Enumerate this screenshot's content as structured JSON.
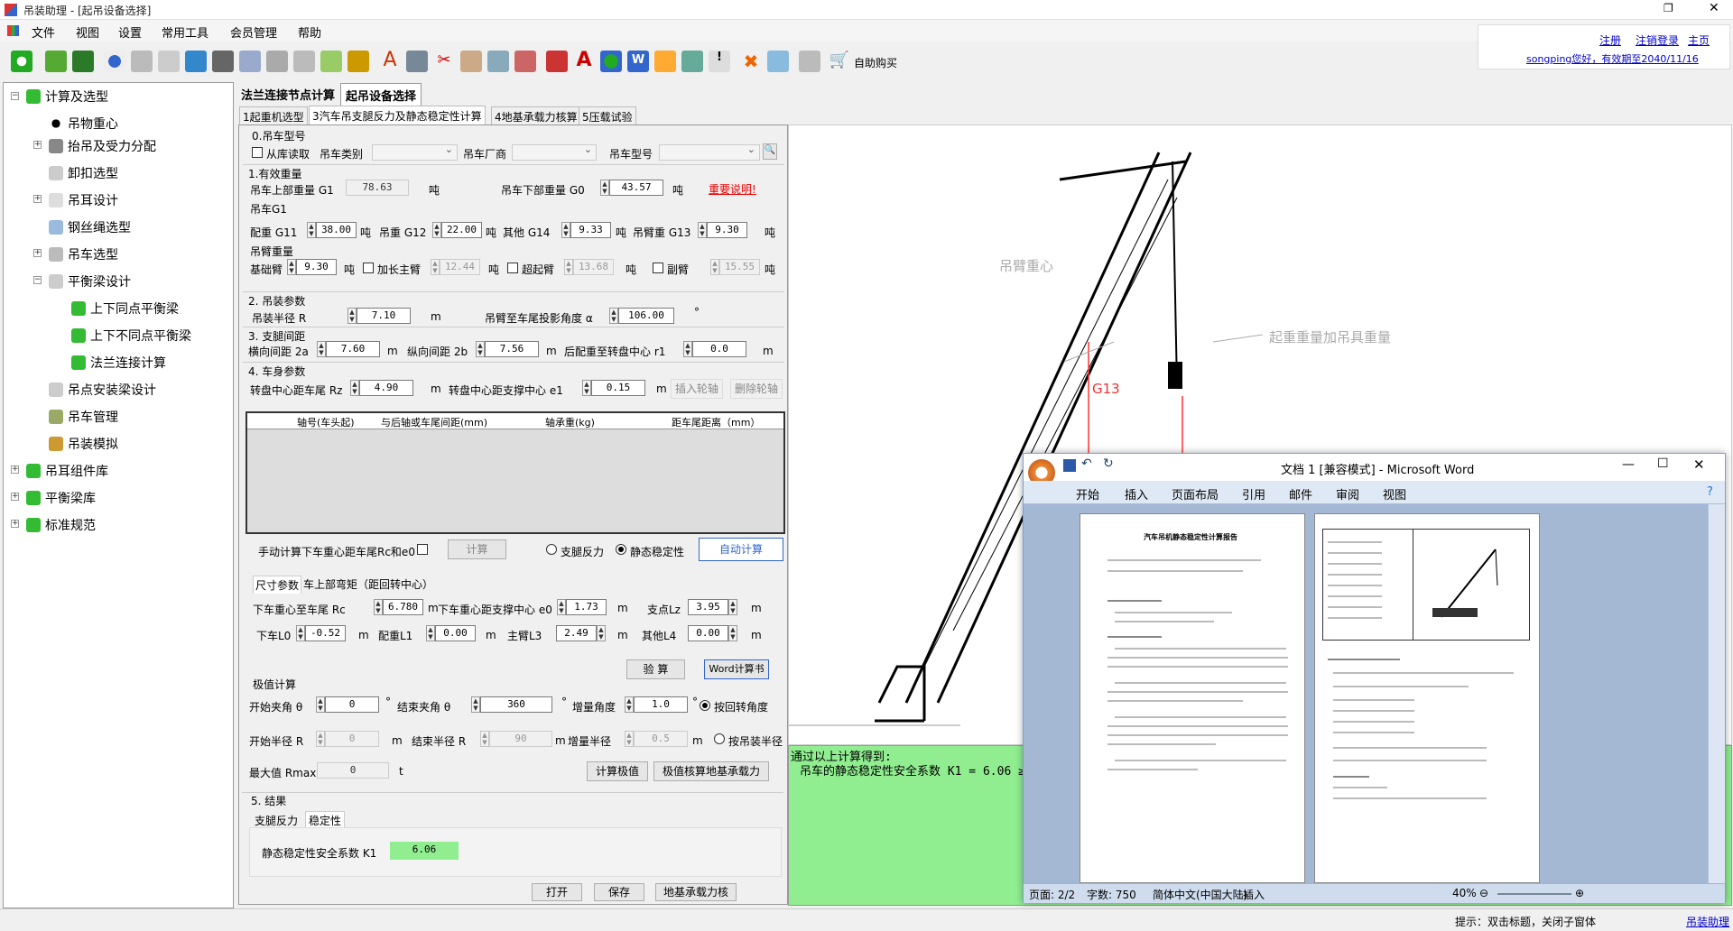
{
  "app": {
    "title": "吊装助理 - [起吊设备选择]"
  },
  "menu": [
    "文件",
    "视图",
    "设置",
    "常用工具",
    "会员管理",
    "帮助"
  ],
  "toolbar": {
    "buy": "自助购买"
  },
  "user": {
    "register": "注册",
    "logout": "注销登录",
    "home": "主页",
    "greeting": "songping您好，有效期至2040/11/16"
  },
  "tree": {
    "root": "计算及选型",
    "items": [
      "吊物重心",
      "抬吊及受力分配",
      "卸扣选型",
      "吊耳设计",
      "钢丝绳选型",
      "吊车选型",
      "平衡梁设计"
    ],
    "sub": [
      "上下同点平衡梁",
      "上下不同点平衡梁",
      "法兰连接计算"
    ],
    "items2": [
      "吊点安装梁设计",
      "吊车管理",
      "吊装模拟"
    ],
    "roots": [
      "吊耳组件库",
      "平衡梁库",
      "标准规范"
    ]
  },
  "tabs": [
    "法兰连接节点计算",
    "起吊设备选择"
  ],
  "subtabs": [
    "1起重机选型",
    "3汽车吊支腿反力及静态稳定性计算",
    "4地基承载力核算",
    "5压载试验"
  ],
  "s0": {
    "title": "0.吊车型号",
    "from_lib": "从库读取",
    "type": "吊车类别",
    "maker": "吊车厂商",
    "model": "吊车型号"
  },
  "s1": {
    "title": "1.有效重量",
    "upper": "吊车上部重量 G1",
    "upper_v": "78.63",
    "unit": "吨",
    "lower": "吊车下部重量 G0",
    "lower_v": "43.57",
    "note": "重要说明!",
    "g1": "吊车G1",
    "cw": "配重 G11",
    "cw_v": "38.00",
    "hook": "吊重 G12",
    "hook_v": "22.00",
    "other": "其他 G14",
    "other_v": "9.33",
    "boom": "吊臂重 G13",
    "boom_v": "9.30",
    "bw": "吊臂重量",
    "base": "基础臂",
    "base_v": "9.30",
    "ext": "加长主臂",
    "ext_v": "12.44",
    "super": "超起臂",
    "super_v": "13.68",
    "jib": "副臂",
    "jib_v": "15.55"
  },
  "s2": {
    "title": "2. 吊装参数",
    "radius": "吊装半径 R",
    "radius_v": "7.10",
    "m": "m",
    "angle": "吊臂至车尾投影角度 α",
    "angle_v": "106.00",
    "deg": "°"
  },
  "s3": {
    "title": "3. 支腿间距",
    "lat": "横向间距 2a",
    "lat_v": "7.60",
    "lon": "纵向间距 2b",
    "lon_v": "7.56",
    "rear": "后配重至转盘中心 r1",
    "rear_v": "0.0"
  },
  "s4": {
    "title": "4. 车身参数",
    "rz": "转盘中心距车尾 Rz",
    "rz_v": "4.90",
    "e1": "转盘中心距支撑中心 e1",
    "e1_v": "0.15",
    "ins": "插入轮轴",
    "del": "删除轮轴"
  },
  "grid": {
    "h": [
      "轴号(车头起)",
      "与后轴或车尾间距(mm)",
      "轴承重(kg)",
      "距车尾距离（mm）"
    ]
  },
  "calc": {
    "manual": "手动计算下车重心距车尾Rc和e0",
    "calc": "计算",
    "r1": "支腿反力",
    "r2": "静态稳定性",
    "auto": "自动计算"
  },
  "dims": {
    "t1": "尺寸参数",
    "t2": "车上部弯矩（距回转中心）",
    "rc": "下车重心至车尾 Rc",
    "rc_v": "6.780",
    "e0": "下车重心距支撑中心 e0",
    "e0_v": "1.73",
    "lz": "支点Lz",
    "lz_v": "3.95",
    "l0": "下车L0",
    "l0_v": "-0.52",
    "l1": "配重L1",
    "l1_v": "0.00",
    "l3": "主臂L3",
    "l3_v": "2.49",
    "l4": "其他L4",
    "l4_v": "0.00",
    "check": "验 算",
    "word": "Word计算书"
  },
  "ext": {
    "title": "极值计算",
    "sa": "开始夹角 θ",
    "sa_v": "0",
    "ea": "结束夹角 θ",
    "ea_v": "360",
    "ia": "增量角度",
    "ia_v": "1.0",
    "byang": "按回转角度",
    "sr": "开始半径 R",
    "sr_v": "0",
    "er": "结束半径 R",
    "er_v": "90",
    "ir": "增量半径",
    "ir_v": "0.5",
    "byrad": "按吊装半径",
    "max": "最大值 Rmax",
    "max_v": "0",
    "t": "t",
    "calcmax": "计算极值",
    "ground": "极值核算地基承载力"
  },
  "s5": {
    "title": "5. 结果",
    "t1": "支腿反力",
    "t2": "稳定性",
    "k1": "静态稳定性安全系数 K1",
    "k1_v": "6.06",
    "open": "打开",
    "save": "保存",
    "ground": "地基承载力核"
  },
  "view": {
    "boomc": "吊臂重心",
    "load": "起重重量加吊具重量",
    "g13": "G13"
  },
  "result": {
    "l1": "通过以上计算得到:",
    "l2": "吊车的静态稳定性安全系数 K1 = 6.06 ≥ 1.4"
  },
  "word": {
    "title": "文档 1 [兼容模式] - Microsoft Word",
    "tabs": [
      "开始",
      "插入",
      "页面布局",
      "引用",
      "邮件",
      "审阅",
      "视图"
    ],
    "doctitle": "汽车吊机静态稳定性计算报告",
    "page": "页面: 2/2",
    "words": "字数: 750",
    "lang": "简体中文(中国大陆)",
    "ins": "插入",
    "zoom": "40%"
  },
  "status": {
    "hint": "提示：双击标题，关闭子窗体",
    "link": "吊装助理"
  }
}
